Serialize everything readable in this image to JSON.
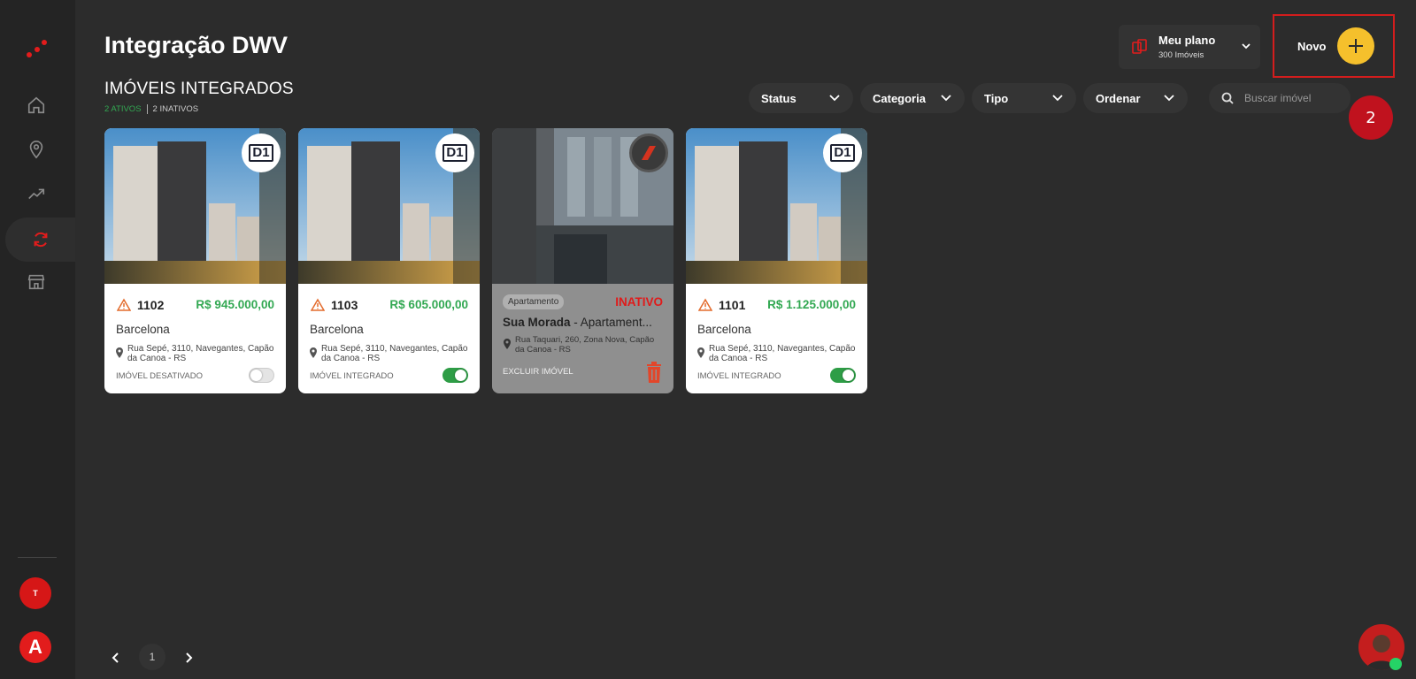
{
  "header": {
    "title": "Integração DWV",
    "section_title": "IMÓVEIS INTEGRADOS",
    "active_count": "2 ATIVOS",
    "inactive_count": "2 INATIVOS"
  },
  "plan": {
    "title": "Meu plano",
    "subtitle": "300 Imóveis"
  },
  "new_button": {
    "label": "Novo",
    "step_number": "2"
  },
  "filters": [
    {
      "label": "Status"
    },
    {
      "label": "Categoria"
    },
    {
      "label": "Tipo"
    },
    {
      "label": "Ordenar"
    }
  ],
  "search": {
    "placeholder": "Buscar imóvel"
  },
  "cards": [
    {
      "unit": "1102",
      "price": "R$ 945.000,00",
      "name": "Barcelona",
      "address": "Rua Sepé, 3110, Navegantes, Capão da Canoa - RS",
      "status": "IMÓVEL DESATIVADO",
      "enabled": false
    },
    {
      "unit": "1103",
      "price": "R$ 605.000,00",
      "name": "Barcelona",
      "address": "Rua Sepé, 3110, Navegantes, Capão da Canoa - RS",
      "status": "IMÓVEL INTEGRADO",
      "enabled": true
    },
    {
      "category": "Apartamento",
      "inactive_label": "INATIVO",
      "name_bold": "Sua Morada",
      "name_rest": " - Apartament...",
      "address": "Rua Taquari, 260, Zona Nova, Capão da Canoa - RS",
      "delete_label": "EXCLUIR IMÓVEL"
    },
    {
      "unit": "1101",
      "price": "R$ 1.125.000,00",
      "name": "Barcelona",
      "address": "Rua Sepé, 3110, Navegantes, Capão da Canoa - RS",
      "status": "IMÓVEL INTEGRADO",
      "enabled": true
    }
  ],
  "badge_text": "D1",
  "pagination": {
    "current": "1"
  },
  "sidebar": {
    "user_initial_small": "T",
    "user_initial_large": "A"
  },
  "colors": {
    "accent_red": "#e21c1c",
    "accent_yellow": "#f5c02c",
    "price_green": "#32a852"
  }
}
